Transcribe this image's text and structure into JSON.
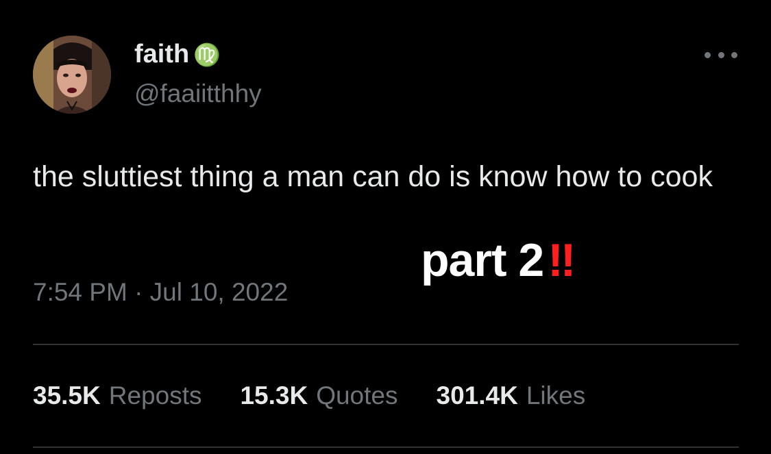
{
  "author": {
    "display_name": "faith",
    "zodiac_glyph": "♍",
    "handle": "@faaiitthhy",
    "avatar_icon": "profile-photo"
  },
  "tweet": {
    "text": "the sluttiest thing a man can do is know how to cook",
    "timestamp": "7:54 PM · Jul 10, 2022"
  },
  "overlay": {
    "text": "part 2",
    "emoji": "‼"
  },
  "stats": [
    {
      "count": "35.5K",
      "label": "Reposts"
    },
    {
      "count": "15.3K",
      "label": "Quotes"
    },
    {
      "count": "301.4K",
      "label": "Likes"
    }
  ],
  "colors": {
    "background": "#000000",
    "primary_text": "#e7e9ea",
    "secondary_text": "#71767b",
    "divider": "#2f3336",
    "accent_red": "#ff1f1f"
  }
}
